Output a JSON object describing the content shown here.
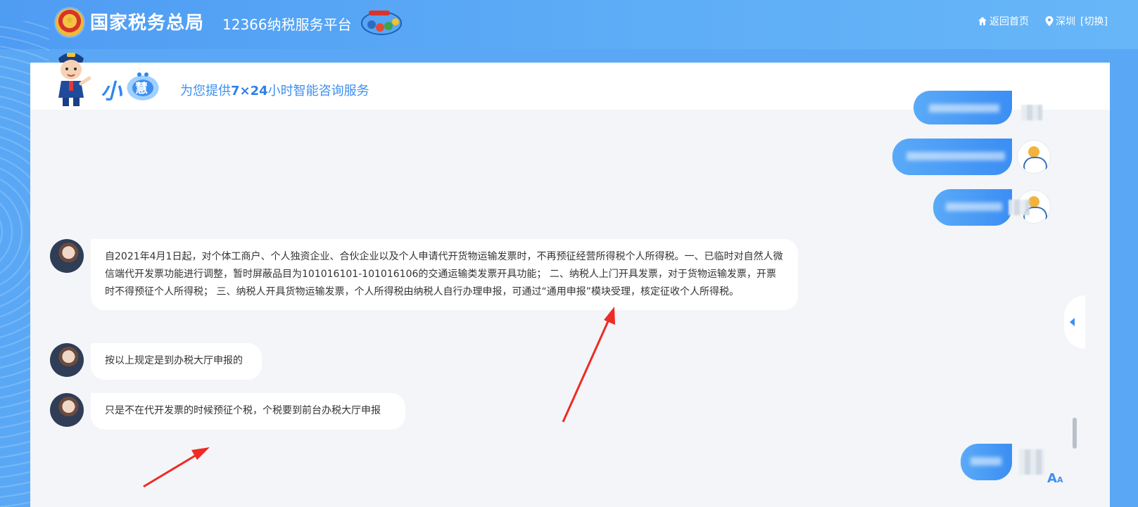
{
  "header": {
    "site_title": "国家税务总局",
    "platform_title": "12366纳税服务平台",
    "nav": {
      "home": "返回首页",
      "city": "深圳",
      "switch": "[切换]"
    }
  },
  "banner": {
    "xiao": "小",
    "hui": "慧",
    "tagline_prefix": "为您提供",
    "tagline_highlight": "7×24",
    "tagline_suffix": "小时智能咨询服务"
  },
  "messages": [
    {
      "role": "bot",
      "text": "自2021年4月1日起，对个体工商户、个人独资企业、合伙企业以及个人申请代开货物运输发票时，不再预征经营所得税个人所得税。一、已临时对自然人微信端代开发票功能进行调整，暂时屏蔽品目为101016101-101016106的交通运输类发票开具功能； 二、纳税人上门开具发票，对于货物运输发票，开票时不得预征个人所得税； 三、纳税人开具货物运输发票，个人所得税由纳税人自行办理申报，可通过“通用申报”模块受理，核定征收个人所得税。"
    },
    {
      "role": "user",
      "text": "按以上规定是到办税大厅申报的"
    },
    {
      "role": "user",
      "text": "只是不在代开发票的时候预征个税，个税要到前台办税大厅申报"
    }
  ],
  "icons": {
    "home": "home-icon",
    "location": "location-pin-icon",
    "collapse": "chevron-left-icon",
    "font_size": "font-size-icon"
  },
  "colors": {
    "accent": "#3d8ff0",
    "user_bubble": "#4a9cf6",
    "annotation": "#ee2b24"
  },
  "font_icon": {
    "big": "A",
    "small": "A"
  }
}
